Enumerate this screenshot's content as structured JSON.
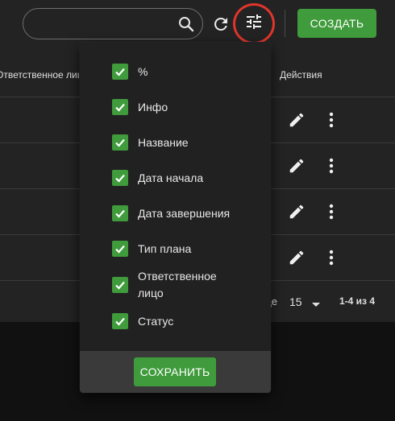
{
  "toolbar": {
    "search_placeholder": "",
    "create_label": "СОЗДАТЬ",
    "accent_color": "#3f9b3c",
    "highlight_color": "#e0352b"
  },
  "table": {
    "headers": {
      "responsible": "Ответственное лицо",
      "actions": "Действия"
    },
    "rows": [
      {
        "actions": [
          "edit-icon",
          "more-vert-icon"
        ]
      },
      {
        "actions": [
          "edit-icon",
          "more-vert-icon"
        ]
      },
      {
        "actions": [
          "edit-icon",
          "more-vert-icon"
        ]
      },
      {
        "actions": [
          "edit-icon",
          "more-vert-icon"
        ]
      }
    ]
  },
  "pagination": {
    "rows_per_page_label": "Строк на странице:",
    "page_size": "15",
    "range": "1-4 из 4"
  },
  "column_menu": {
    "items": [
      {
        "label": "%",
        "checked": true
      },
      {
        "label": "Инфо",
        "checked": true
      },
      {
        "label": "Название",
        "checked": true
      },
      {
        "label": "Дата начала",
        "checked": true
      },
      {
        "label": "Дата завершения",
        "checked": true
      },
      {
        "label": "Тип плана",
        "checked": true
      },
      {
        "label": "Ответственное лицо",
        "checked": true
      },
      {
        "label": "Статус",
        "checked": true
      }
    ],
    "save_label": "СОХРАНИТЬ"
  }
}
